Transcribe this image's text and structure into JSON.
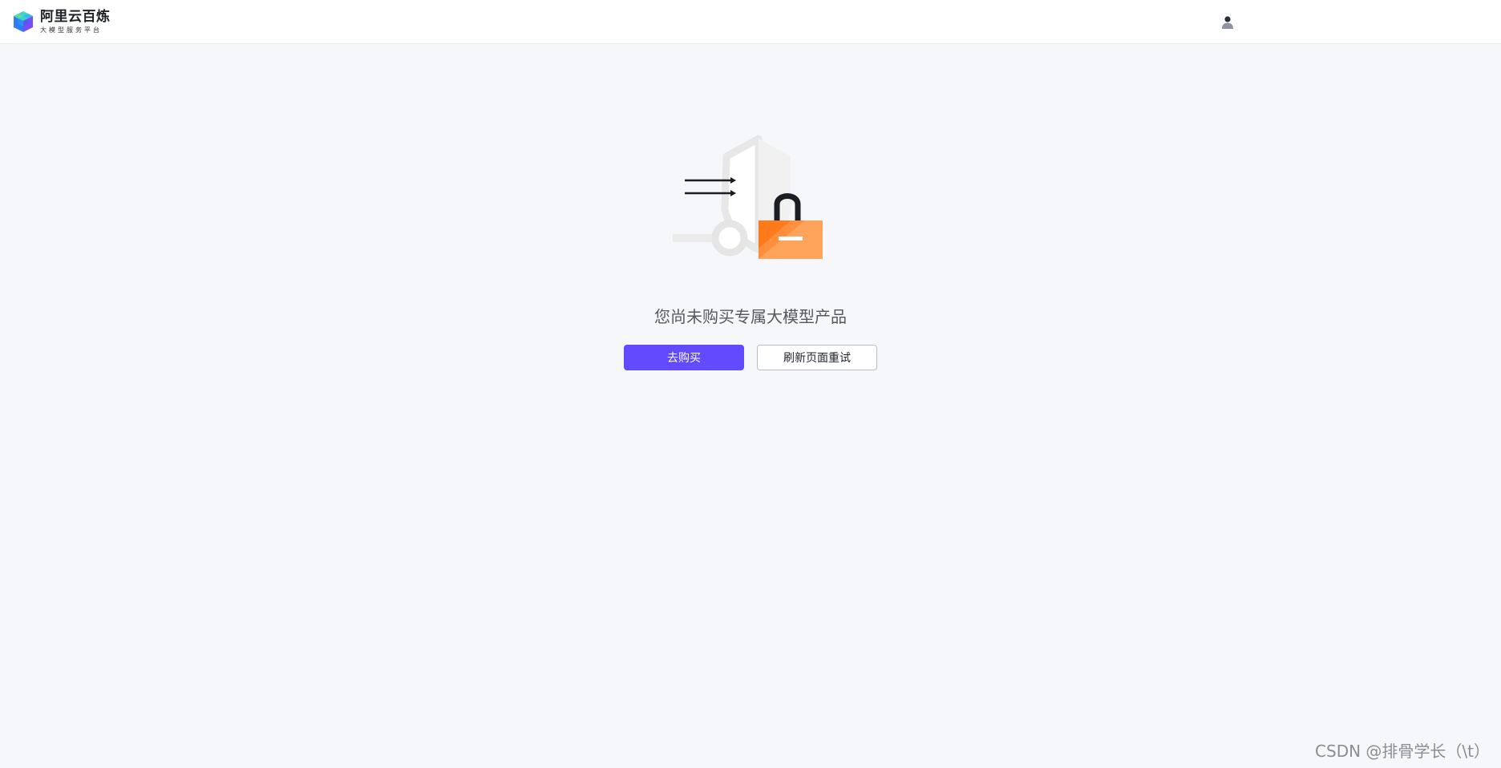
{
  "header": {
    "logo_title": "阿里云百炼",
    "logo_subtitle": "大模型服务平台"
  },
  "empty_state": {
    "message": "您尚未购买专属大模型产品",
    "buy_label": "去购买",
    "refresh_label": "刷新页面重试"
  },
  "watermark": "CSDN @排骨学长（\\t）",
  "icons": {
    "logo": "cube-logo-icon",
    "user": "user-icon",
    "illustration": "locked-shield-illustration"
  },
  "colors": {
    "primary": "#624aff",
    "lock_orange": "#ff8a33",
    "background": "#f6f7fb"
  }
}
